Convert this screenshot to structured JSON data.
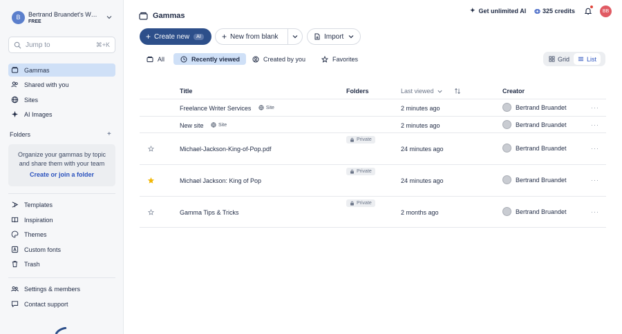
{
  "workspace": {
    "avatar_letter": "B",
    "name": "Bertrand Bruandet's Workspace",
    "plan": "FREE"
  },
  "search": {
    "placeholder": "Jump to",
    "shortcut": "⌘+K"
  },
  "nav": [
    {
      "label": "Gammas",
      "icon": "gammas-icon",
      "active": true
    },
    {
      "label": "Shared with you",
      "icon": "shared-icon"
    },
    {
      "label": "Sites",
      "icon": "globe-icon"
    },
    {
      "label": "AI Images",
      "icon": "sparkle-icon"
    }
  ],
  "folders": {
    "title": "Folders",
    "description": "Organize your gammas by topic and share them with your team",
    "link": "Create or join a folder"
  },
  "nav_bottom": [
    {
      "label": "Templates",
      "icon": "templates-icon"
    },
    {
      "label": "Inspiration",
      "icon": "book-icon"
    },
    {
      "label": "Themes",
      "icon": "palette-icon"
    },
    {
      "label": "Custom fonts",
      "icon": "font-icon"
    },
    {
      "label": "Trash",
      "icon": "trash-icon"
    }
  ],
  "nav_footer": [
    {
      "label": "Settings & members",
      "icon": "people-icon"
    },
    {
      "label": "Contact support",
      "icon": "chat-icon"
    }
  ],
  "header": {
    "title": "Gammas",
    "unlimited": "Get unlimited AI",
    "credits": "325 credits",
    "user_initials": "BB"
  },
  "actions": {
    "create_new": "Create new",
    "ai_badge": "AI",
    "new_from_blank": "New from blank",
    "import": "Import"
  },
  "filters": [
    {
      "label": "All",
      "icon": "folder-icon"
    },
    {
      "label": "Recently viewed",
      "icon": "clock-icon",
      "active": true
    },
    {
      "label": "Created by you",
      "icon": "user-circle-icon"
    },
    {
      "label": "Favorites",
      "icon": "star-icon"
    }
  ],
  "view_toggle": {
    "grid": "Grid",
    "list": "List",
    "active": "list"
  },
  "table": {
    "columns": {
      "title": "Title",
      "folders": "Folders",
      "last_viewed": "Last viewed",
      "creator": "Creator"
    },
    "rows": [
      {
        "title": "Freelance Writer Services",
        "site_badge": "Site",
        "folder": "",
        "last_viewed": "2 minutes ago",
        "creator": "Bertrand Bruandet",
        "favorite": null
      },
      {
        "title": "New site",
        "site_badge": "Site",
        "folder": "",
        "last_viewed": "2 minutes ago",
        "creator": "Bertrand Bruandet",
        "favorite": null
      },
      {
        "title": "Michael-Jackson-King-of-Pop.pdf",
        "site_badge": "",
        "folder": "Private",
        "last_viewed": "24 minutes ago",
        "creator": "Bertrand Bruandet",
        "favorite": false
      },
      {
        "title": "Michael Jackson: King of Pop",
        "site_badge": "",
        "folder": "Private",
        "last_viewed": "24 minutes ago",
        "creator": "Bertrand Bruandet",
        "favorite": true
      },
      {
        "title": "Gamma Tips & Tricks",
        "site_badge": "",
        "folder": "Private",
        "last_viewed": "2 months ago",
        "creator": "Bertrand Bruandet",
        "favorite": false
      }
    ]
  },
  "colors": {
    "accent": "#2d4f8a",
    "active_bg": "#cfe0f7",
    "favorite": "#f2b705",
    "avatar": "#e05a63"
  }
}
